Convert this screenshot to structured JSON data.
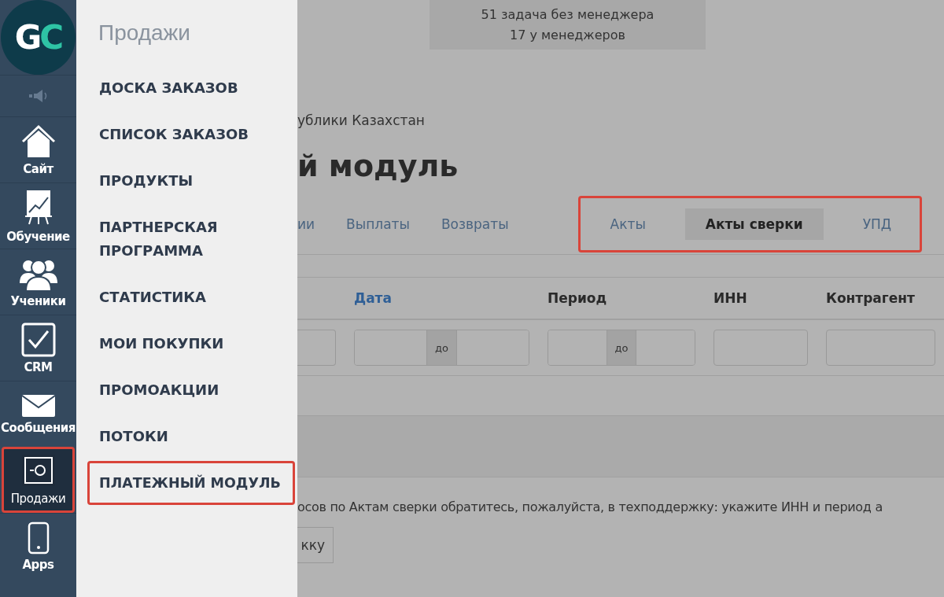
{
  "logo": {
    "letters": [
      {
        "text": "G",
        "color": "#ffffff"
      },
      {
        "text": "C",
        "color": "#2ec4a5"
      }
    ]
  },
  "nav": [
    {
      "kind": "sound",
      "selected": false,
      "highlighted": false
    },
    {
      "kind": "home",
      "label": "Сайт",
      "selected": false,
      "highlighted": false
    },
    {
      "kind": "chart",
      "label": "Обучение",
      "selected": false,
      "highlighted": false
    },
    {
      "kind": "people",
      "label": "Ученики",
      "selected": false,
      "highlighted": false
    },
    {
      "kind": "check",
      "label": "CRM",
      "selected": false,
      "highlighted": false
    },
    {
      "kind": "mail",
      "label": "Сообщения",
      "selected": false,
      "highlighted": false
    },
    {
      "kind": "safe",
      "label": "Продажи",
      "selected": true,
      "highlighted": true
    },
    {
      "kind": "phone",
      "label": "Apps",
      "selected": false,
      "highlighted": false
    }
  ],
  "menu": {
    "title": "Продажи",
    "items": [
      {
        "label": "ДОСКА ЗАКАЗОВ",
        "highlighted": false
      },
      {
        "label": "СПИСОК ЗАКАЗОВ",
        "highlighted": false
      },
      {
        "label": "ПРОДУКТЫ",
        "highlighted": false
      },
      {
        "label": "ПАРТНЕРСКАЯ ПРОГРАММА",
        "highlighted": false
      },
      {
        "label": "СТАТИСТИКА",
        "highlighted": false
      },
      {
        "label": "МОИ ПОКУПКИ",
        "highlighted": false
      },
      {
        "label": "ПРОМОАКЦИИ",
        "highlighted": false
      },
      {
        "label": "ПОТОКИ",
        "highlighted": false
      },
      {
        "label": "ПЛАТЕЖНЫЙ МОДУЛЬ",
        "highlighted": true
      }
    ]
  },
  "task_banner": [
    "51 задача без менеджера",
    "17 у менеджеров"
  ],
  "subtitle": "ублики Казахстан",
  "page_title": "й модуль",
  "tab_groups": [
    {
      "highlighted": false,
      "tabs": [
        {
          "label": "ии",
          "selected": false
        },
        {
          "label": "Выплаты",
          "selected": false
        },
        {
          "label": "Возвраты",
          "selected": false
        }
      ]
    },
    {
      "highlighted": true,
      "tabs": [
        {
          "label": "Акты",
          "selected": false
        },
        {
          "label": "Акты сверки",
          "selected": true
        },
        {
          "label": "УПД",
          "selected": false
        }
      ]
    }
  ],
  "columns": [
    {
      "kind": "single"
    },
    {
      "label": "Дата",
      "kind": "range",
      "sortable": true,
      "separator": "до"
    },
    {
      "label": "Период",
      "kind": "range",
      "sortable": false,
      "separator": "до"
    },
    {
      "label": "ИНН",
      "kind": "single",
      "sortable": false
    },
    {
      "label": "Контрагент",
      "kind": "single",
      "sortable": false
    }
  ],
  "message": "осов по Актам сверки обратитесь, пожалуйста, в техподдержку: укажите ИНН и период а",
  "support_button": "кку"
}
